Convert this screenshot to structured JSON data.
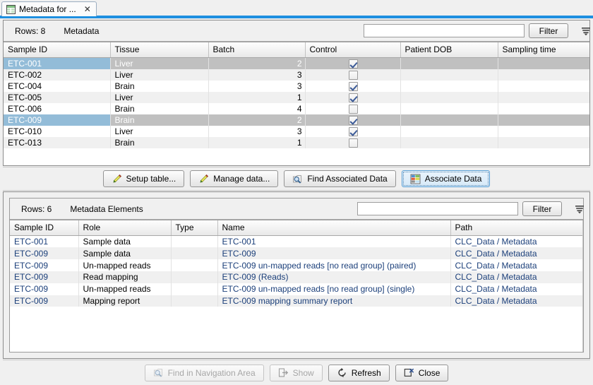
{
  "window": {
    "tab_title": "Metadata for ...",
    "tab_icon": "table-icon",
    "close_icon": "close-icon"
  },
  "metadata_panel": {
    "rows_label": "Rows: 8",
    "table_name": "Metadata",
    "filter": {
      "value": "",
      "placeholder": "",
      "button_label": "Filter",
      "menu_icon": "filter-settings-icon"
    },
    "columns": [
      "Sample ID",
      "Tissue",
      "Batch",
      "Control",
      "Patient DOB",
      "Sampling time"
    ],
    "rows": [
      {
        "sample_id": "ETC-001",
        "tissue": "Liver",
        "batch": "2",
        "control": true,
        "patient_dob": "",
        "sampling_time": "",
        "selected": true
      },
      {
        "sample_id": "ETC-002",
        "tissue": "Liver",
        "batch": "3",
        "control": false,
        "patient_dob": "",
        "sampling_time": "",
        "selected": false
      },
      {
        "sample_id": "ETC-004",
        "tissue": "Brain",
        "batch": "3",
        "control": true,
        "patient_dob": "",
        "sampling_time": "",
        "selected": false
      },
      {
        "sample_id": "ETC-005",
        "tissue": "Liver",
        "batch": "1",
        "control": true,
        "patient_dob": "",
        "sampling_time": "",
        "selected": false
      },
      {
        "sample_id": "ETC-006",
        "tissue": "Brain",
        "batch": "4",
        "control": false,
        "patient_dob": "",
        "sampling_time": "",
        "selected": false
      },
      {
        "sample_id": "ETC-009",
        "tissue": "Brain",
        "batch": "2",
        "control": true,
        "patient_dob": "",
        "sampling_time": "",
        "selected": true
      },
      {
        "sample_id": "ETC-010",
        "tissue": "Liver",
        "batch": "3",
        "control": true,
        "patient_dob": "",
        "sampling_time": "",
        "selected": false
      },
      {
        "sample_id": "ETC-013",
        "tissue": "Brain",
        "batch": "1",
        "control": false,
        "patient_dob": "",
        "sampling_time": "",
        "selected": false
      }
    ]
  },
  "action_buttons": [
    {
      "label": "Setup table...",
      "icon": "pencil-icon",
      "state": "normal"
    },
    {
      "label": "Manage data...",
      "icon": "pencil-icon",
      "state": "normal"
    },
    {
      "label": "Find Associated Data",
      "icon": "find-data-icon",
      "state": "normal"
    },
    {
      "label": "Associate Data",
      "icon": "associate-data-icon",
      "state": "focused"
    }
  ],
  "elements_panel": {
    "rows_label": "Rows: 6",
    "table_name": "Metadata Elements",
    "filter": {
      "value": "",
      "placeholder": "",
      "button_label": "Filter",
      "menu_icon": "filter-settings-icon"
    },
    "columns": [
      "Sample ID",
      "Role",
      "Type",
      "Name",
      "Path"
    ],
    "rows": [
      {
        "sample_id": "ETC-001",
        "role": "Sample data",
        "type_icon": "reads-track-icon",
        "name": "ETC-001",
        "path": "CLC_Data / Metadata"
      },
      {
        "sample_id": "ETC-009",
        "role": "Sample data",
        "type_icon": "reads-track-icon",
        "name": "ETC-009",
        "path": "CLC_Data / Metadata"
      },
      {
        "sample_id": "ETC-009",
        "role": "Un-mapped reads",
        "type_icon": "reads-track-icon",
        "name": "ETC-009 un-mapped reads [no read group] (paired)",
        "path": "CLC_Data / Metadata"
      },
      {
        "sample_id": "ETC-009",
        "role": "Read mapping",
        "type_icon": "read-mapping-icon",
        "name": "ETC-009 (Reads)",
        "path": "CLC_Data / Metadata"
      },
      {
        "sample_id": "ETC-009",
        "role": "Un-mapped reads",
        "type_icon": "reads-track-icon",
        "name": "ETC-009 un-mapped reads [no read group] (single)",
        "path": "CLC_Data / Metadata"
      },
      {
        "sample_id": "ETC-009",
        "role": "Mapping report",
        "type_icon": "report-icon",
        "name": "ETC-009 mapping summary report",
        "path": "CLC_Data / Metadata"
      }
    ]
  },
  "footer_buttons": [
    {
      "label": "Find in Navigation Area",
      "icon": "find-data-icon",
      "state": "disabled"
    },
    {
      "label": "Show",
      "icon": "show-icon",
      "state": "disabled"
    },
    {
      "label": "Refresh",
      "icon": "refresh-icon",
      "state": "normal"
    },
    {
      "label": "Close",
      "icon": "close-window-icon",
      "state": "normal"
    }
  ],
  "colors": {
    "accent": "#1e8fe0",
    "selection_focus": "#93bcd8",
    "selection": "#c0c0c0",
    "row_alt": "#f0f0f0",
    "panel_bg": "#f0f0f0"
  }
}
